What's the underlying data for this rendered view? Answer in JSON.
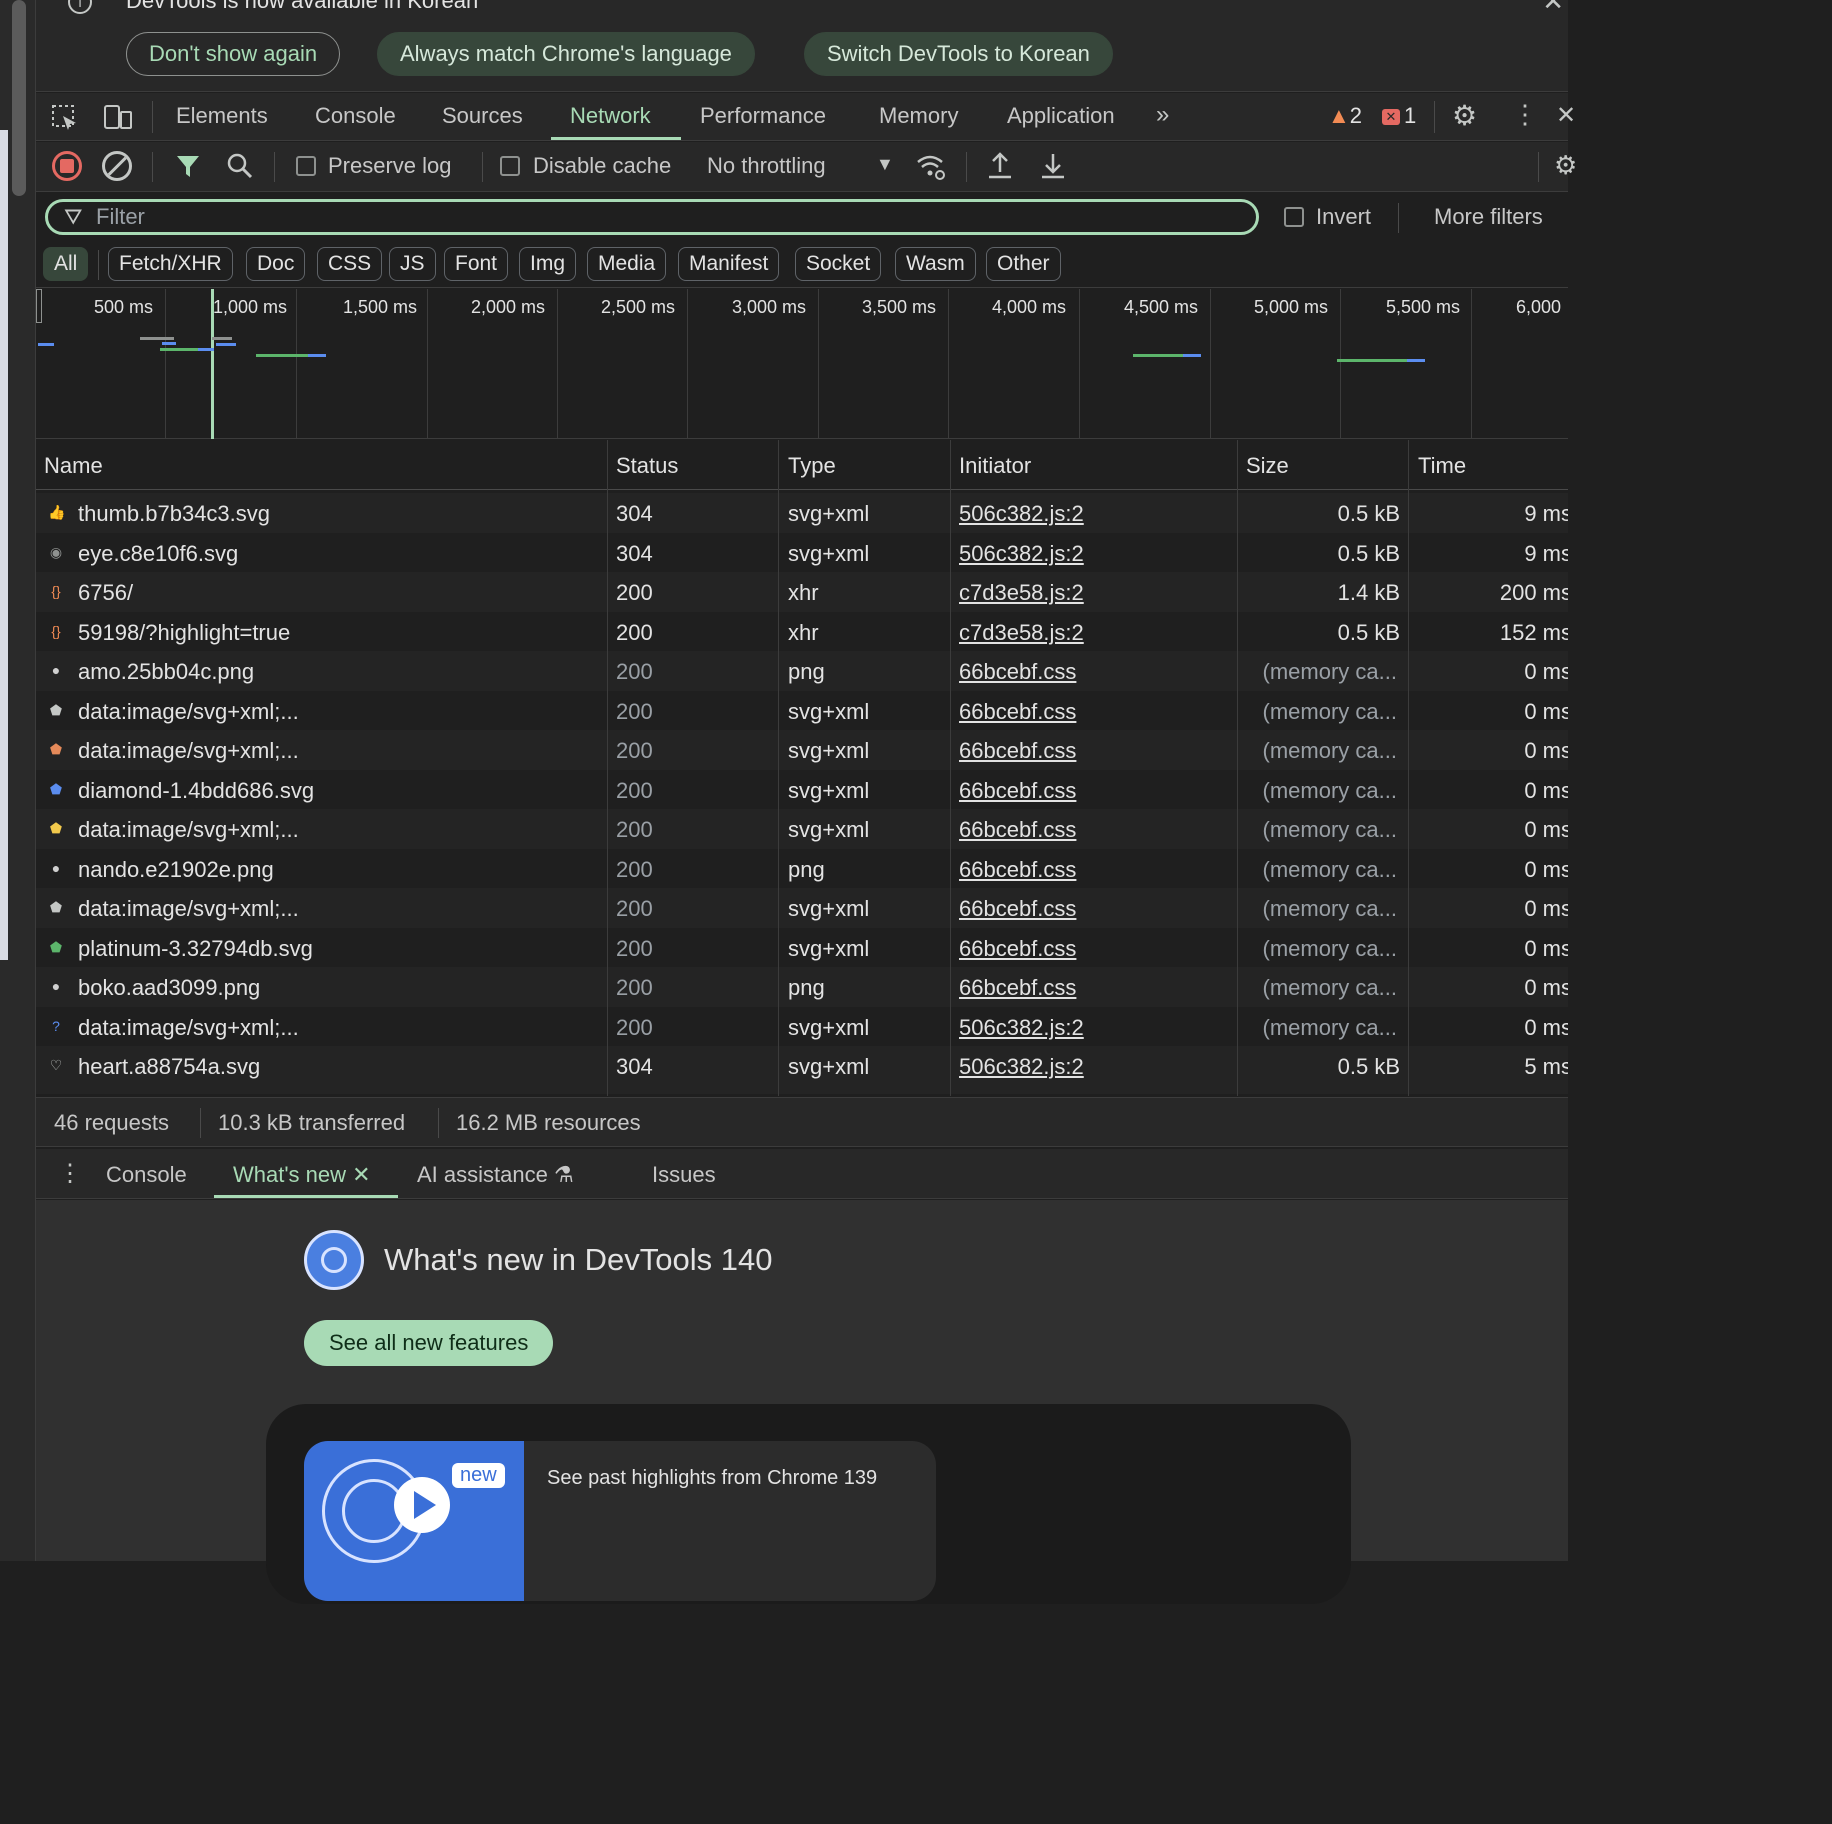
{
  "infobar": {
    "message": "DevTools is now available in Korean",
    "buttons": [
      "Don't show again",
      "Always match Chrome's language",
      "Switch DevTools to Korean"
    ]
  },
  "tabs": {
    "items": [
      "Elements",
      "Console",
      "Sources",
      "Network",
      "Performance",
      "Memory",
      "Application"
    ],
    "active": "Network",
    "warnings": "2",
    "errors": "1"
  },
  "toolbar": {
    "preserve_log": "Preserve log",
    "disable_cache": "Disable cache",
    "throttling": "No throttling"
  },
  "filter": {
    "placeholder": "Filter",
    "invert": "Invert",
    "more_filters": "More filters"
  },
  "type_filters": [
    "All",
    "Fetch/XHR",
    "Doc",
    "CSS",
    "JS",
    "Font",
    "Img",
    "Media",
    "Manifest",
    "Socket",
    "Wasm",
    "Other"
  ],
  "overview": {
    "ticks": [
      "500 ms",
      "1,000 ms",
      "1,500 ms",
      "2,000 ms",
      "2,500 ms",
      "3,000 ms",
      "3,500 ms",
      "4,000 ms",
      "4,500 ms",
      "5,000 ms",
      "5,500 ms",
      "6,000"
    ]
  },
  "table": {
    "headers": [
      "Name",
      "Status",
      "Type",
      "Initiator",
      "Size",
      "Time"
    ],
    "rows": [
      {
        "icon": "thumb-icon",
        "name": "thumb.b7b34c3.svg",
        "status": "304",
        "type": "svg+xml",
        "initiator": "506c382.js:2",
        "size": "0.5 kB",
        "time": "9 ms"
      },
      {
        "icon": "eye-icon",
        "name": "eye.c8e10f6.svg",
        "status": "304",
        "type": "svg+xml",
        "initiator": "506c382.js:2",
        "size": "0.5 kB",
        "time": "9 ms"
      },
      {
        "icon": "xhr-icon",
        "name": "6756/",
        "status": "200",
        "type": "xhr",
        "initiator": "c7d3e58.js:2",
        "size": "1.4 kB",
        "time": "200 ms"
      },
      {
        "icon": "xhr-icon",
        "name": "59198/?highlight=true",
        "status": "200",
        "type": "xhr",
        "initiator": "c7d3e58.js:2",
        "size": "0.5 kB",
        "time": "152 ms"
      },
      {
        "icon": "png-icon",
        "name": "amo.25bb04c.png",
        "status": "200",
        "type": "png",
        "initiator": "66bcebf.css",
        "size": "(memory ca...",
        "time": "0 ms"
      },
      {
        "icon": "shield-grey-icon",
        "name": "data:image/svg+xml;...",
        "status": "200",
        "type": "svg+xml",
        "initiator": "66bcebf.css",
        "size": "(memory ca...",
        "time": "0 ms"
      },
      {
        "icon": "shield-orange-icon",
        "name": "data:image/svg+xml;...",
        "status": "200",
        "type": "svg+xml",
        "initiator": "66bcebf.css",
        "size": "(memory ca...",
        "time": "0 ms"
      },
      {
        "icon": "diamond-icon",
        "name": "diamond-1.4bdd686.svg",
        "status": "200",
        "type": "svg+xml",
        "initiator": "66bcebf.css",
        "size": "(memory ca...",
        "time": "0 ms"
      },
      {
        "icon": "shield-yellow-icon",
        "name": "data:image/svg+xml;...",
        "status": "200",
        "type": "svg+xml",
        "initiator": "66bcebf.css",
        "size": "(memory ca...",
        "time": "0 ms"
      },
      {
        "icon": "png-icon",
        "name": "nando.e21902e.png",
        "status": "200",
        "type": "png",
        "initiator": "66bcebf.css",
        "size": "(memory ca...",
        "time": "0 ms"
      },
      {
        "icon": "shield-grey-icon",
        "name": "data:image/svg+xml;...",
        "status": "200",
        "type": "svg+xml",
        "initiator": "66bcebf.css",
        "size": "(memory ca...",
        "time": "0 ms"
      },
      {
        "icon": "platinum-icon",
        "name": "platinum-3.32794db.svg",
        "status": "200",
        "type": "svg+xml",
        "initiator": "66bcebf.css",
        "size": "(memory ca...",
        "time": "0 ms"
      },
      {
        "icon": "png-icon",
        "name": "boko.aad3099.png",
        "status": "200",
        "type": "png",
        "initiator": "66bcebf.css",
        "size": "(memory ca...",
        "time": "0 ms"
      },
      {
        "icon": "help-icon",
        "name": "data:image/svg+xml;...",
        "status": "200",
        "type": "svg+xml",
        "initiator": "506c382.js:2",
        "size": "(memory ca...",
        "time": "0 ms"
      },
      {
        "icon": "heart-icon",
        "name": "heart.a88754a.svg",
        "status": "304",
        "type": "svg+xml",
        "initiator": "506c382.js:2",
        "size": "0.5 kB",
        "time": "5 ms"
      }
    ]
  },
  "summary": {
    "requests": "46 requests",
    "transferred": "10.3 kB transferred",
    "resources": "16.2 MB resources"
  },
  "drawer": {
    "tabs": [
      "Console",
      "What's new",
      "AI assistance",
      "Issues"
    ],
    "active": "What's new"
  },
  "whats_new": {
    "title": "What's new in DevTools 140",
    "button": "See all new features",
    "badge": "new",
    "past": "See past highlights from Chrome 139"
  },
  "colors": {
    "accent": "#a8dab5",
    "record": "#e46962",
    "warning": "#f28b54",
    "link_blue": "#5b8def"
  }
}
